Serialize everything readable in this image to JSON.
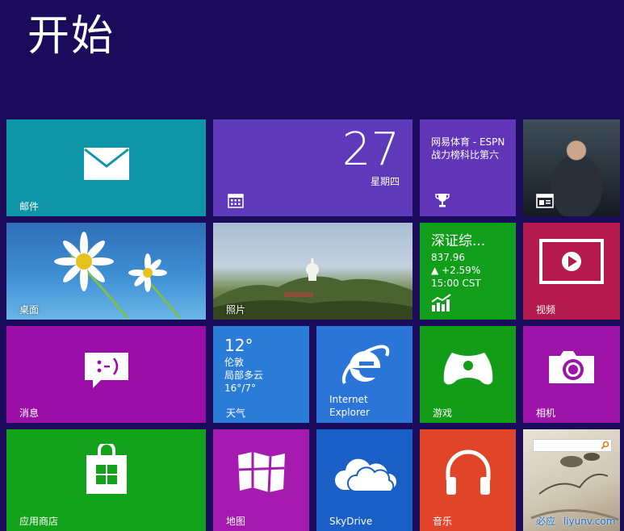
{
  "title": "开始",
  "tiles": {
    "mail": {
      "label": "邮件",
      "icon": "mail-envelope-icon"
    },
    "calendar": {
      "day": "27",
      "weekday": "星期四",
      "icon": "calendar-grid-icon"
    },
    "sports": {
      "headline": "网易体育 - ESPN战力榜科比第六",
      "icon": "trophy-icon"
    },
    "news": {
      "icon": "news-icon"
    },
    "desktop": {
      "label": "桌面"
    },
    "photos": {
      "label": "照片"
    },
    "finance": {
      "name": "深证综...",
      "value": "837.96",
      "change": "▲ +2.59%",
      "time": "15:00 CST",
      "icon": "stock-chart-icon"
    },
    "video": {
      "label": "视频",
      "icon": "play-icon"
    },
    "messaging": {
      "label": "消息",
      "icon": "chat-bubble-icon"
    },
    "weather": {
      "temp": "12°",
      "city": "伦敦",
      "condition": "局部多云",
      "range": "16°/7°",
      "label": "天气"
    },
    "ie": {
      "label_line1": "Internet",
      "label_line2": "Explorer",
      "icon": "internet-explorer-icon"
    },
    "games": {
      "label": "游戏",
      "icon": "gamepad-icon"
    },
    "camera": {
      "label": "相机",
      "icon": "camera-icon"
    },
    "store": {
      "label": "应用商店",
      "icon": "store-bag-icon"
    },
    "maps": {
      "label": "地图",
      "icon": "map-icon"
    },
    "skydrive": {
      "label": "SkyDrive",
      "icon": "cloud-icon"
    },
    "music": {
      "label": "音乐",
      "icon": "headphones-icon"
    },
    "bing": {
      "label": "必应",
      "watermark": "liyunv.com",
      "icon": "search-icon"
    }
  },
  "colors": {
    "background": "#1b0b5b",
    "mail": "#0f95a8",
    "calendar": "#5e39b9",
    "finance": "#119e1a",
    "video": "#b51a4f",
    "messaging": "#9a0da6",
    "weather": "#2b7cd6",
    "music": "#e0452a",
    "store": "#12a11b",
    "maps": "#a51bb0",
    "skydrive": "#1a5fc6"
  }
}
